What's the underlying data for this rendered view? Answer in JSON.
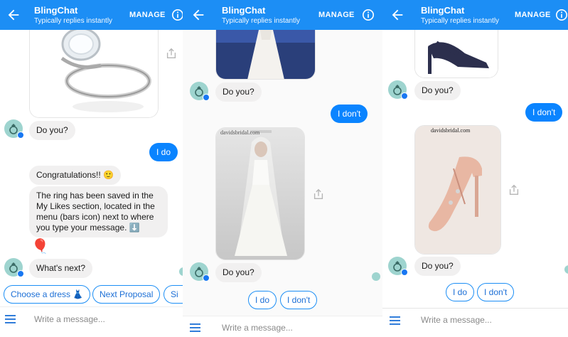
{
  "app": {
    "name": "BlingChat",
    "status": "Typically replies instantly",
    "manage": "MANAGE"
  },
  "panel1": {
    "bot_do_you": "Do you?",
    "user_i_do": "I do",
    "congrats": "Congratulations!! 🙂",
    "saved_msg": "The ring has been saved in the My Likes section, located in the menu (bars icon) next to where you type your message. ⬇️",
    "balloon": "🎈",
    "whats_next": "What's next?",
    "quick_replies": [
      "Choose a dress 👗",
      "Next Proposal",
      "Si"
    ]
  },
  "panel2": {
    "bot_do_you_1": "Do you?",
    "user_i_dont": "I don't",
    "watermark": "davidsbridal.com",
    "bot_do_you_2": "Do you?",
    "quick_replies": [
      "I do",
      "I don't"
    ]
  },
  "panel3": {
    "bot_do_you_1": "Do you?",
    "user_i_dont": "I don't",
    "watermark": "davidsbridal.com",
    "bot_do_you_2": "Do you?",
    "quick_replies": [
      "I do",
      "I don't"
    ]
  },
  "composer": {
    "placeholder": "Write a message..."
  },
  "colors": {
    "header": "#1c8ef5",
    "user_bubble": "#0a84ff",
    "bot_bubble": "#f1f0f0"
  }
}
